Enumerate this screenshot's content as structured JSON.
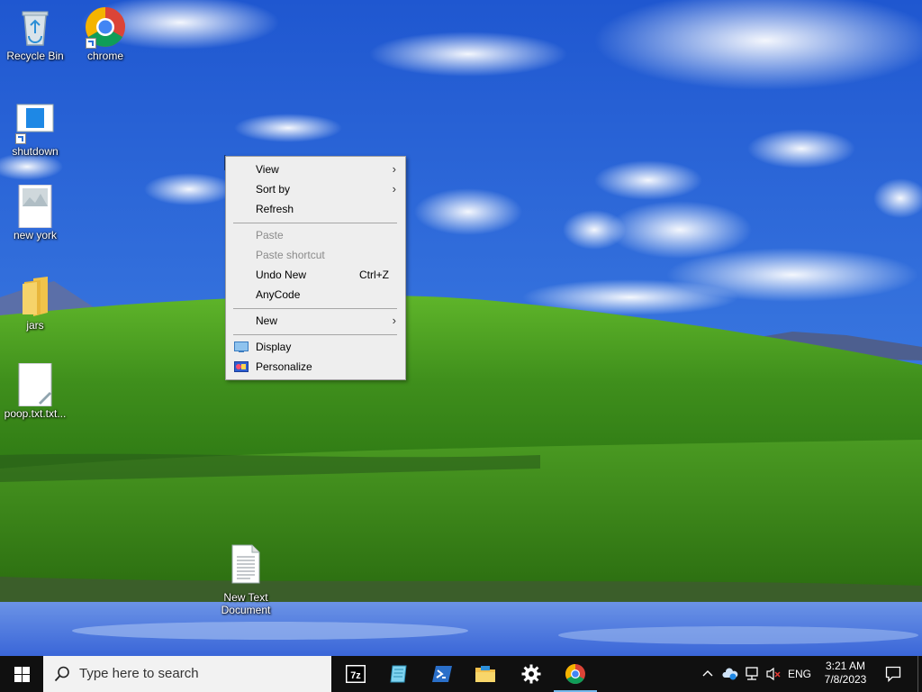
{
  "desktop": {
    "icons": [
      {
        "label": "Recycle Bin",
        "icon": "recycle-bin-icon"
      },
      {
        "label": "chrome",
        "icon": "chrome-icon"
      },
      {
        "label": "shutdown",
        "icon": "shutdown-shortcut-icon"
      },
      {
        "label": "new york",
        "icon": "image-file-icon"
      },
      {
        "label": "jars",
        "icon": "folder-icon"
      },
      {
        "label": "poop.txt.txt...",
        "icon": "text-file-icon"
      },
      {
        "label_line1": "New Text",
        "label_line2": "Document",
        "icon": "text-document-icon"
      }
    ]
  },
  "context_menu": {
    "items": [
      {
        "label": "View",
        "submenu": true,
        "enabled": true
      },
      {
        "label": "Sort by",
        "submenu": true,
        "enabled": true
      },
      {
        "label": "Refresh",
        "enabled": true
      },
      {
        "label": "Paste",
        "enabled": false
      },
      {
        "label": "Paste shortcut",
        "enabled": false
      },
      {
        "label": "Undo New",
        "shortcut": "Ctrl+Z",
        "enabled": true
      },
      {
        "label": "AnyCode",
        "enabled": true
      },
      {
        "label": "New",
        "submenu": true,
        "enabled": true
      },
      {
        "label": "Display",
        "icon": "display-settings-icon",
        "enabled": true
      },
      {
        "label": "Personalize",
        "icon": "personalize-icon",
        "enabled": true
      }
    ]
  },
  "taskbar": {
    "search_placeholder": "Type here to search",
    "apps": [
      "7zip-icon",
      "notepad-icon",
      "powershell-icon",
      "file-explorer-icon",
      "settings-icon",
      "chrome-icon"
    ],
    "tray": {
      "language": "ENG",
      "time": "3:21 AM",
      "date": "7/8/2023"
    }
  },
  "colors": {
    "taskbar": "#101010",
    "menu_bg": "#eeeeee",
    "disabled_text": "#8b8b8b",
    "sky": "#2a62d8",
    "grass": "#3f8f1c"
  }
}
